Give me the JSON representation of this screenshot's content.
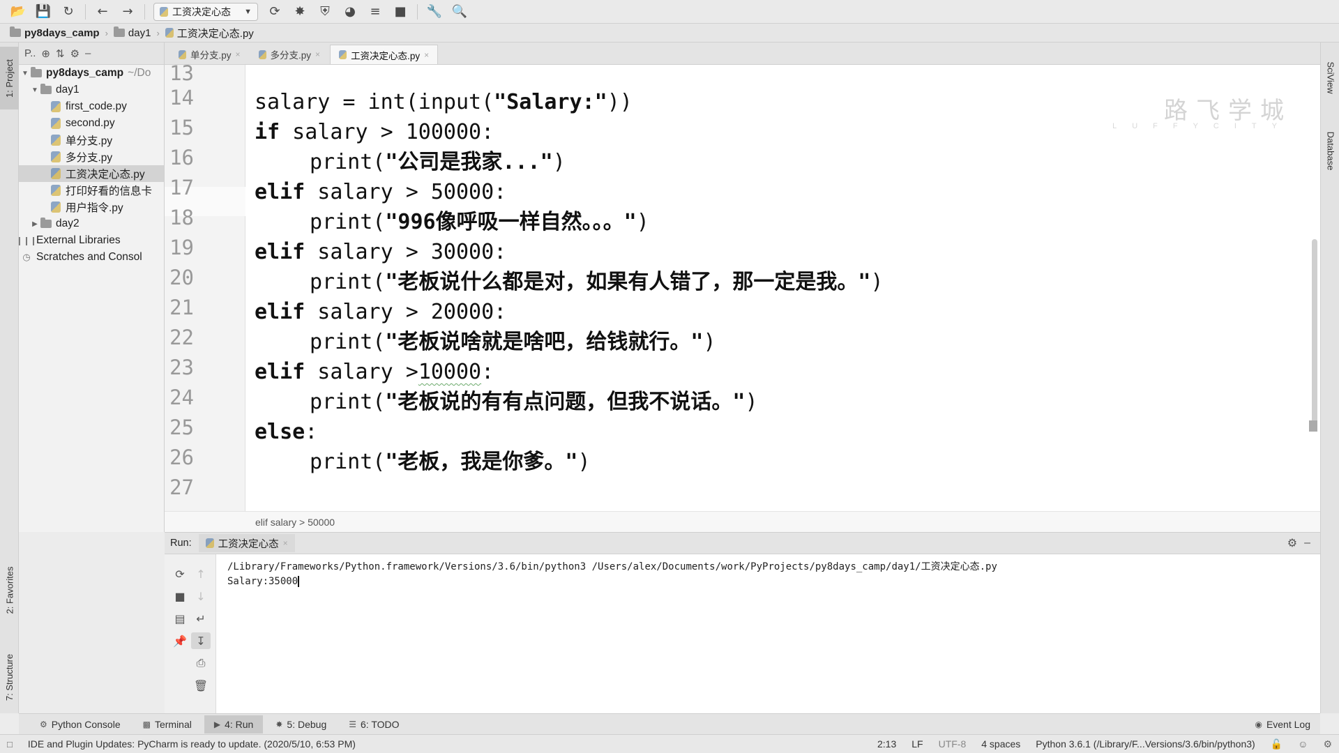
{
  "toolbar": {
    "run_config": "工资决定心态"
  },
  "breadcrumb": {
    "items": [
      "py8days_camp",
      "day1",
      "工资决定心态.py"
    ]
  },
  "left_strip": {
    "project": "1: Project",
    "favorites": "2: Favorites",
    "structure": "7: Structure"
  },
  "right_strip": {
    "sciview": "SciView",
    "database": "Database"
  },
  "project_panel": {
    "header": "P..",
    "root_name": "py8days_camp",
    "root_path": "~/Do",
    "folder_day1": "day1",
    "files": [
      "first_code.py",
      "second.py",
      "单分支.py",
      "多分支.py",
      "工资决定心态.py",
      "打印好看的信息卡",
      "用户指令.py"
    ],
    "folder_day2": "day2",
    "external_libraries": "External Libraries",
    "scratches": "Scratches and Consol"
  },
  "editor_tabs": [
    "单分支.py",
    "多分支.py",
    "工资决定心态.py"
  ],
  "editor": {
    "line_numbers": [
      "13",
      "14",
      "15",
      "16",
      "17",
      "18",
      "19",
      "20",
      "21",
      "22",
      "23",
      "24",
      "25",
      "26",
      "27"
    ],
    "code": {
      "l14a": "salary = int(input(",
      "l14s": "\"Salary:\"",
      "l14b": "))",
      "l15kw": "if",
      "l15": " salary > 100000:",
      "l16a": "print(",
      "l16s": "\"公司是我家...\"",
      "l16b": ")",
      "l17kw": "elif",
      "l17": " salary > 50000:",
      "l18a": "print(",
      "l18s": "\"996像呼吸一样自然。。。\"",
      "l18b": ")",
      "l19kw": "elif",
      "l19": " salary > 30000:",
      "l20a": "print(",
      "l20s": "\"老板说什么都是对，如果有人错了，那一定是我。\"",
      "l20b": ")",
      "l21kw": "elif",
      "l21": " salary > 20000:",
      "l22a": "print(",
      "l22s": "\"老板说啥就是啥吧，给钱就行。\"",
      "l22b": ")",
      "l23kw": "elif",
      "l23a": " salary >",
      "l23b": "10000",
      "l23c": ":",
      "l24a": "print(",
      "l24s": "\"老板说的有有点问题，但我不说话。\"",
      "l24b": ")",
      "l25kw": "else",
      "l25": ":",
      "l26a": "print(",
      "l26s": "\"老板，我是你爹。\"",
      "l26b": ")"
    },
    "breadcrumb": "elif salary > 50000",
    "watermark_cn": "路飞学城",
    "watermark_en": "LUFFYCITY"
  },
  "run": {
    "label": "Run:",
    "tab": "工资决定心态",
    "command": "/Library/Frameworks/Python.framework/Versions/3.6/bin/python3 /Users/alex/Documents/work/PyProjects/py8days_camp/day1/工资决定心态.py",
    "output_prompt": "Salary:35000"
  },
  "bottom_tabs": {
    "python_console": "Python Console",
    "terminal": "Terminal",
    "run": "4: Run",
    "debug": "5: Debug",
    "todo": "6: TODO",
    "event_log": "Event Log"
  },
  "status_bar": {
    "message": "IDE and Plugin Updates: PyCharm is ready to update. (2020/5/10, 6:53 PM)",
    "position": "2:13",
    "line_sep": "LF",
    "encoding": "UTF-8",
    "indent": "4 spaces",
    "interpreter": "Python 3.6.1 (/Library/F...Versions/3.6/bin/python3)"
  }
}
